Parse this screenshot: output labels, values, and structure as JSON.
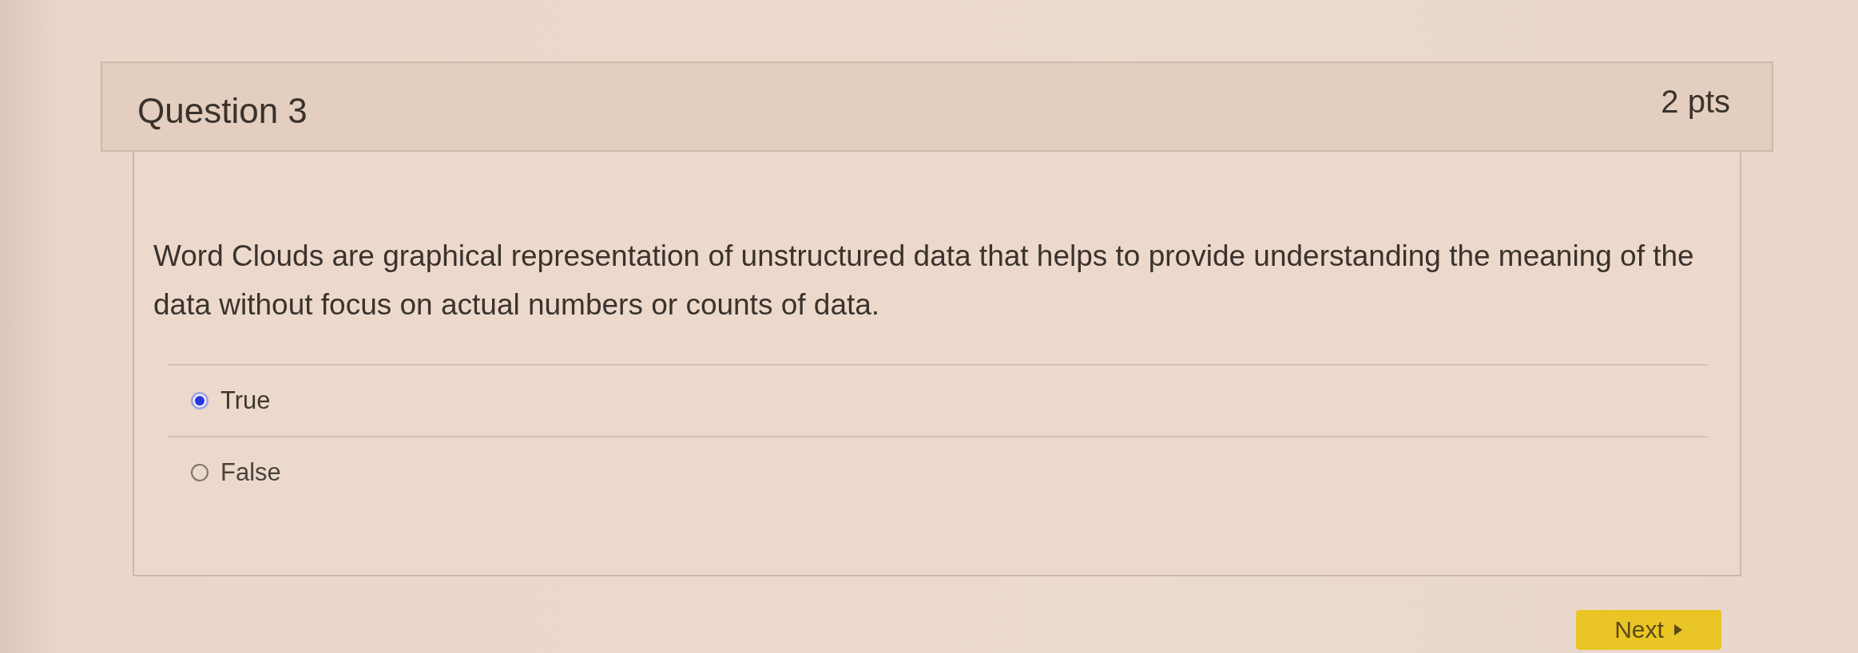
{
  "question": {
    "title": "Question 3",
    "points": "2 pts",
    "text": "Word Clouds are graphical representation of unstructured data that helps to provide understanding the meaning of the data without focus on actual numbers or counts of data.",
    "answers": [
      {
        "label": "True",
        "selected": true
      },
      {
        "label": "False",
        "selected": false
      }
    ]
  },
  "next_button": {
    "label": "Next"
  }
}
